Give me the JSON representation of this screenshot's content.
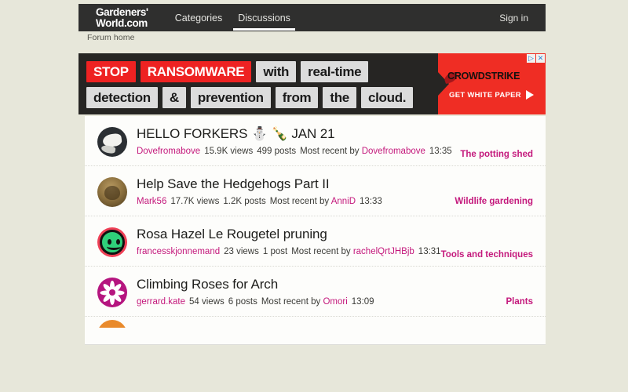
{
  "site": {
    "logo_line1": "Gardeners'",
    "logo_line2": "World.com",
    "breadcrumb": "Forum home",
    "sign_in": "Sign in"
  },
  "nav": {
    "tabs": [
      {
        "label": "Categories",
        "active": false
      },
      {
        "label": "Discussions",
        "active": true
      }
    ]
  },
  "ad": {
    "words_row1": [
      "STOP",
      "RANSOMWARE",
      "with",
      "real-time"
    ],
    "words_row2": [
      "detection",
      "&",
      "prevention",
      "from",
      "the",
      "cloud."
    ],
    "highlight_words": [
      "STOP",
      "RANSOMWARE"
    ],
    "brand": "CROWDSTRIKE",
    "cta": "GET WHITE PAPER",
    "badge_info": "▷",
    "badge_close": "✕",
    "colors": {
      "red": "#ef2d24",
      "dark": "#262523",
      "chip": "#dcdcdc"
    }
  },
  "discussions": [
    {
      "title": "HELLO FORKERS ⛄ 🍾 JAN 21",
      "author": "Dovefromabove",
      "views": "15.9K views",
      "posts": "499 posts",
      "recent_label": "Most recent by",
      "recent_user": "Dovefromabove",
      "time": "13:35",
      "category": "The potting shed",
      "category_position": "below",
      "avatar": "dove-avatar"
    },
    {
      "title": "Help Save the Hedgehogs Part II",
      "author": "Mark56",
      "views": "17.7K views",
      "posts": "1.2K posts",
      "recent_label": "Most recent by",
      "recent_user": "AnniD",
      "time": "13:33",
      "category": "Wildlife gardening",
      "category_position": "inline",
      "avatar": "hedgehog-avatar"
    },
    {
      "title": "Rosa Hazel Le Rougetel pruning",
      "author": "francesskjonnemand",
      "views": "23 views",
      "posts": "1 post",
      "recent_label": "Most recent by",
      "recent_user": "rachelQrtJHBjb",
      "time": "13:31",
      "category": "Tools and techniques",
      "category_position": "below",
      "avatar": "smiley-avatar"
    },
    {
      "title": "Climbing Roses for Arch",
      "author": "gerrard.kate",
      "views": "54 views",
      "posts": "6 posts",
      "recent_label": "Most recent by",
      "recent_user": "Omori",
      "time": "13:09",
      "category": "Plants",
      "category_position": "inline",
      "avatar": "flower-avatar"
    }
  ],
  "theme": {
    "page_background": "#e7e7da",
    "nav_background": "#2f2f2e",
    "link_accent": "#c4197c",
    "content_background": "#fdfdfb"
  }
}
